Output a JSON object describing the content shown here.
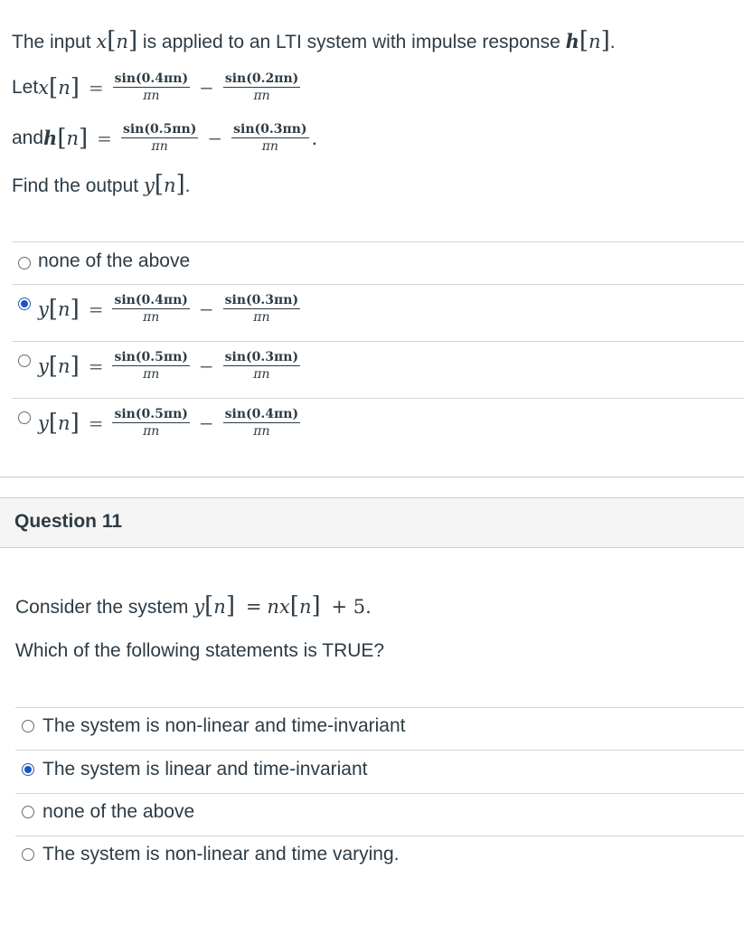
{
  "q10": {
    "intro_before": "The input ",
    "intro_middle": " is applied to an LTI system with impulse response ",
    "intro_end": ".",
    "x_label": "Let ",
    "h_label": "and ",
    "find_before": "Find the output ",
    "find_end": ".",
    "sym": {
      "x": "x",
      "h": "h",
      "y": "y",
      "n": "n",
      "eq": "=",
      "minus": "−",
      "lb": "[",
      "rb": "]",
      "den": "πn"
    },
    "x_num1": "sin(0.4πn)",
    "x_num2": "sin(0.2πn)",
    "h_num1": "sin(0.5πn)",
    "h_num2": "sin(0.3πn)",
    "h_period": ".",
    "options": [
      {
        "label": "none of the above",
        "selected": false
      },
      {
        "num1": "sin(0.4πn)",
        "num2": "sin(0.3πn)",
        "selected": true
      },
      {
        "num1": "sin(0.5πn)",
        "num2": "sin(0.3πn)",
        "selected": false
      },
      {
        "num1": "sin(0.5πn)",
        "num2": "sin(0.4πn)",
        "selected": false
      }
    ]
  },
  "q11": {
    "title": "Question 11",
    "consider_before": "Consider the system ",
    "eq_tail": "+ 5.",
    "sym_nx": "nx",
    "prompt": "Which of the following statements is TRUE?",
    "options": [
      {
        "label": "The system is non-linear and time-invariant",
        "selected": false
      },
      {
        "label": "The system is linear and time-invariant",
        "selected": true
      },
      {
        "label": "none of the above",
        "selected": false
      },
      {
        "label": "The system is non-linear and time varying.",
        "selected": false
      }
    ]
  },
  "colors": {
    "text": "#2d3b45",
    "radio_selected": "#1a55c7",
    "divider": "#d5d5d5",
    "header_bg": "#f5f5f5"
  }
}
